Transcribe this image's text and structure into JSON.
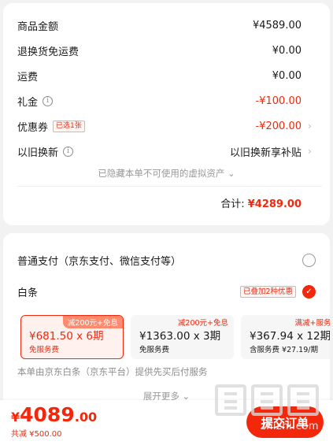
{
  "summary": {
    "rows": [
      {
        "label": "商品金额",
        "value": "¥4589.00"
      },
      {
        "label": "退换货免运费",
        "value": "¥0.00"
      },
      {
        "label": "运费",
        "value": "¥0.00"
      },
      {
        "label": "礼金",
        "value": "-¥100.00"
      },
      {
        "label": "优惠券",
        "tag": "已选1张",
        "value": "-¥200.00"
      },
      {
        "label": "以旧换新",
        "value": "以旧换新享补贴"
      }
    ],
    "hidden_hint": "已隐藏本单不可使用的虚拟资产",
    "total_label": "合计:",
    "total_amount": "¥4289.00"
  },
  "payment": {
    "normal_label": "普通支付（京东支付、微信支付等）",
    "baitiao_label": "白条",
    "baitiao_promo": "已叠加2种优惠",
    "plans": [
      {
        "badge": "减200元+免息",
        "main": "¥681.50 x 6期",
        "sub": "免服务费",
        "selected": true
      },
      {
        "badge": "减200元+免息",
        "main": "¥1363.00 x 3期",
        "sub": "免服务费",
        "selected": false
      },
      {
        "badge": "满减+服务费",
        "main": "¥367.94 x 12期",
        "sub": "含服务费 ¥27.19/期",
        "selected": false
      }
    ],
    "service_note": "本单由京东白条（京东平台）提供先买后付服务",
    "expand_label": "展开更多"
  },
  "bottom": {
    "currency": "¥",
    "amount_int": "4089",
    "amount_dec": ".00",
    "saved": "共减 ¥500.00",
    "submit_label": "提交订单"
  },
  "watermark": "zhizhi.com",
  "colors": {
    "accent": "#f2270c",
    "background": "#f2f2f2"
  }
}
